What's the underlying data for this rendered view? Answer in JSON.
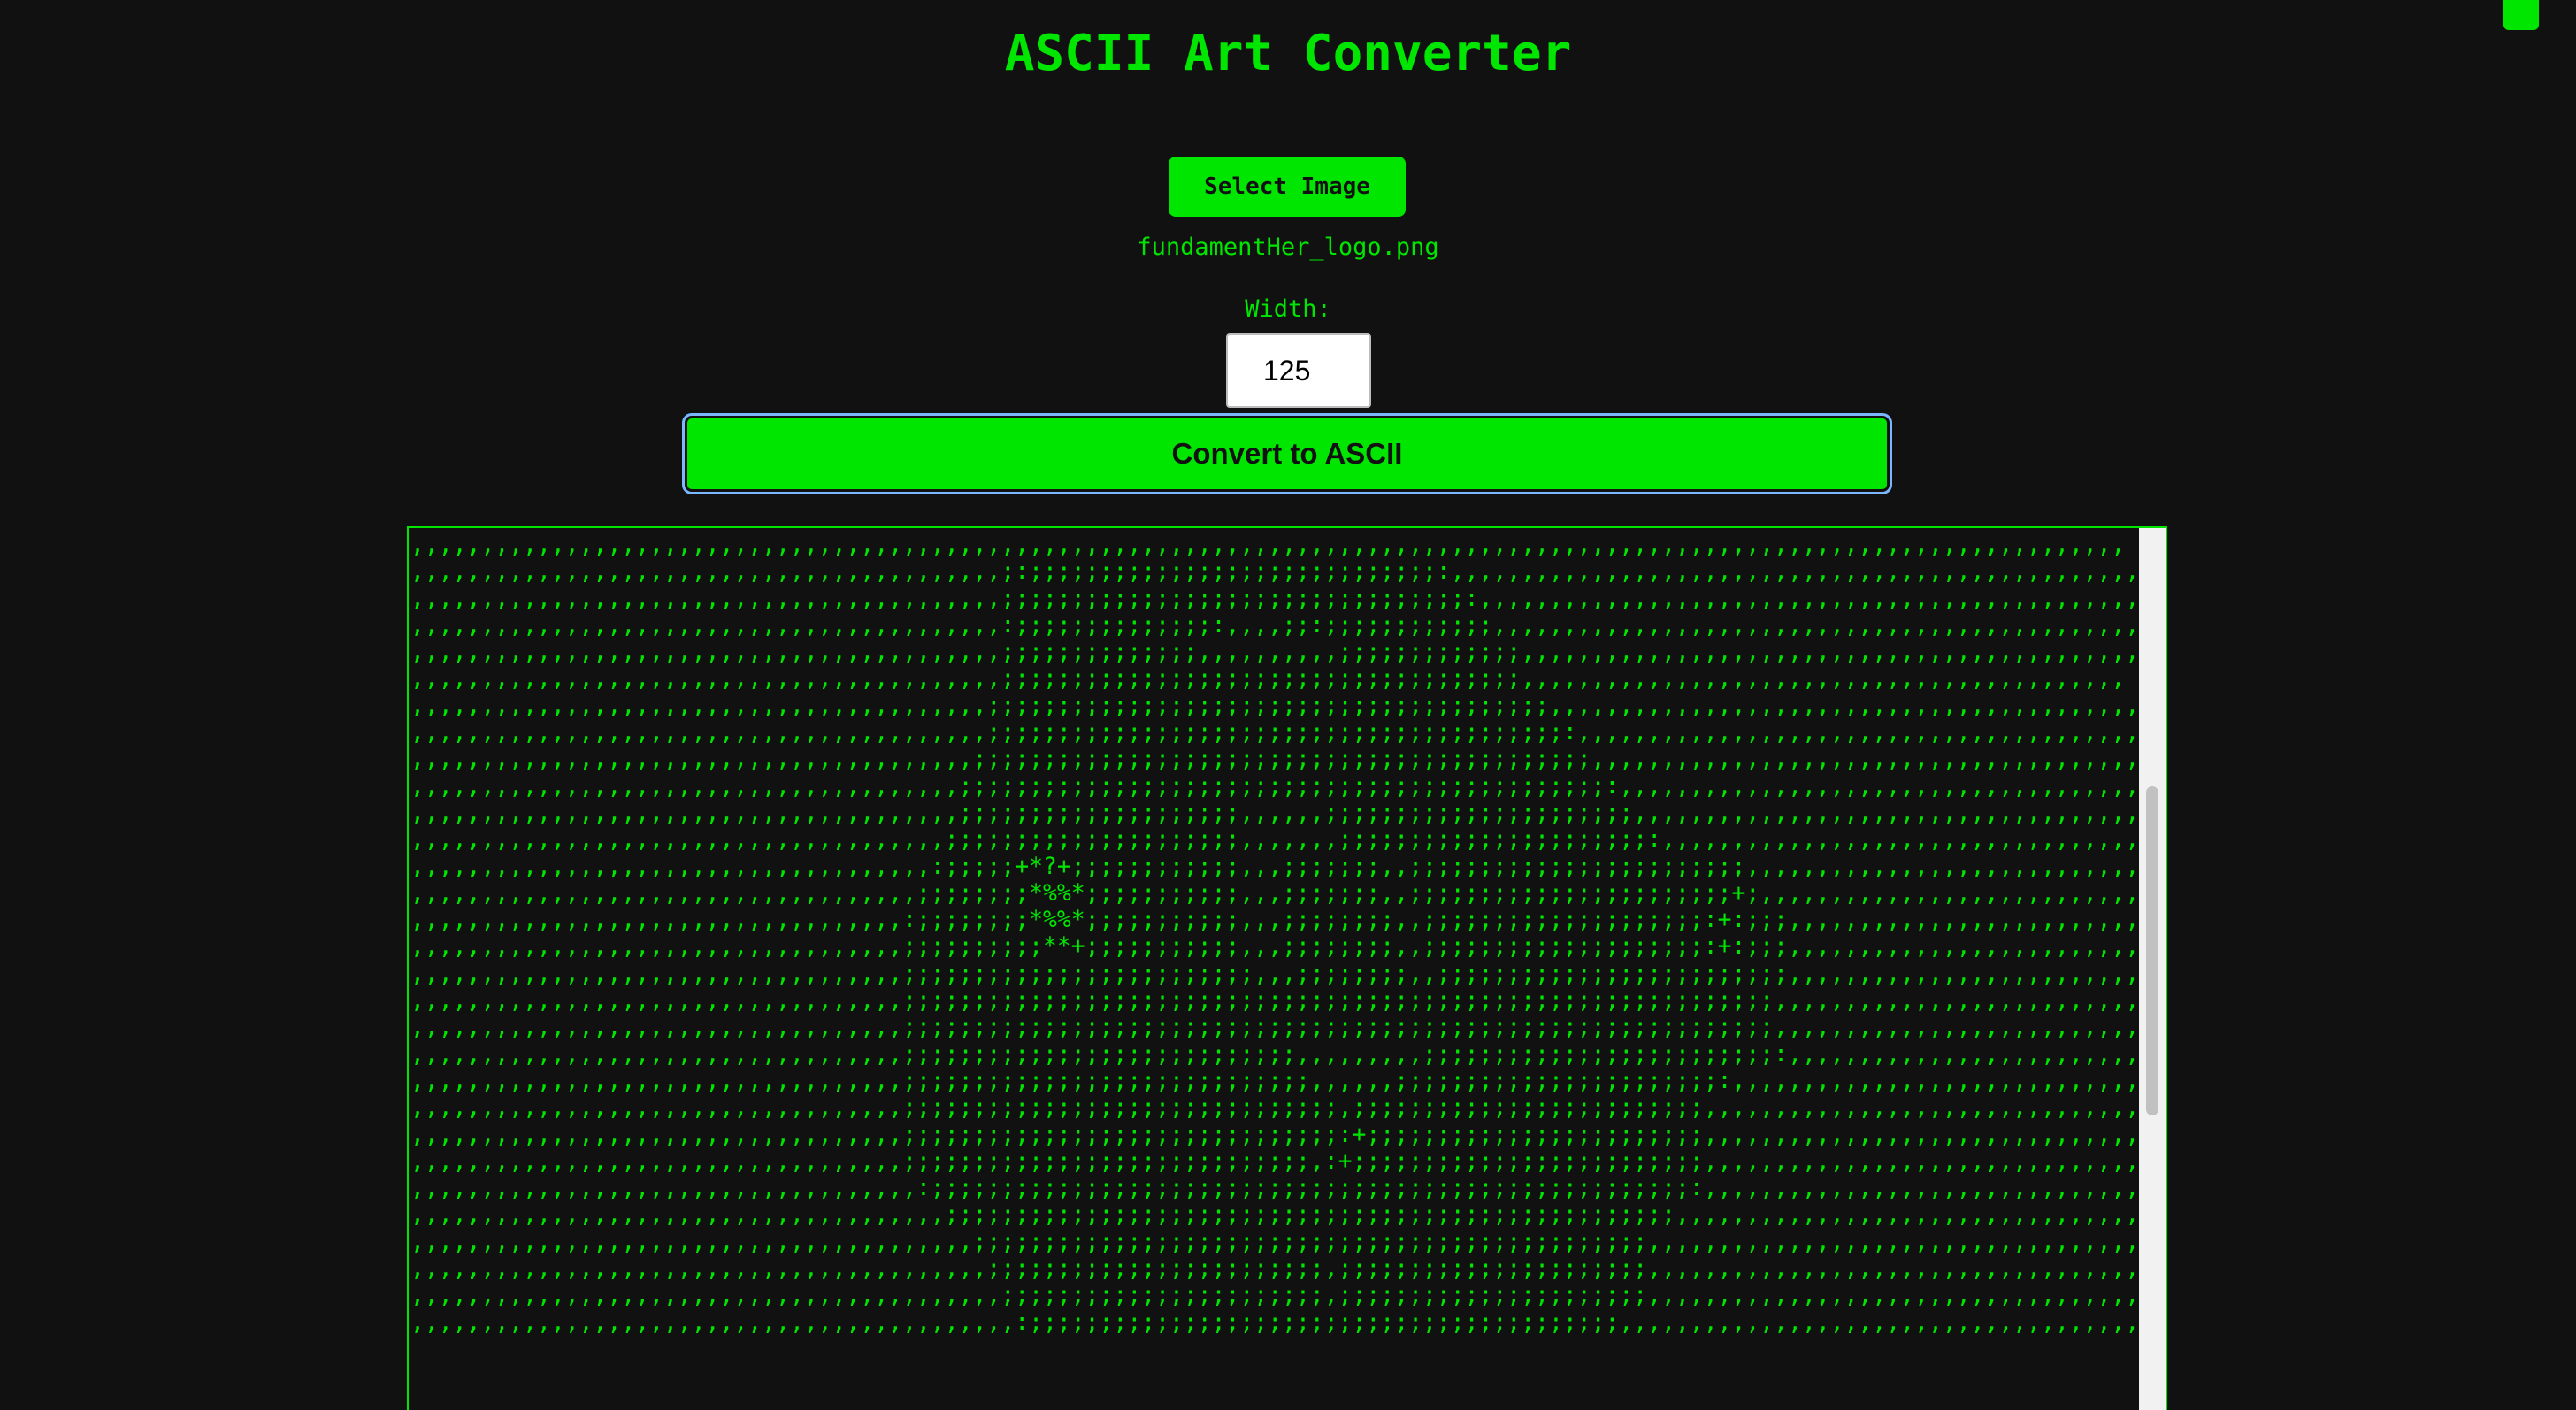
{
  "header": {
    "title": "ASCII Art Converter"
  },
  "controls": {
    "select_label": "Select Image",
    "file_name": "fundamentHer_logo.png",
    "width_label": "Width:",
    "width_value": "125",
    "convert_label": "Convert to ASCII"
  },
  "output": {
    "ascii_text": ",,,,,,,,,,,,,,,,,,,,,,,,,,,,,,,,,,,,,,,,,,,,,,,,,,,,,,,,,,,,,,,,,,,,,,,,,,,,,,,,,,,,,,,,,,,,,,,,,,,,,,,,,,,,,,,,,,,,,,,,,,\n,,,,,,,,,,,,,,,,,,,,,,,,,,,,,,,,,,,,,,,,,,;:;;;;;;;;;;;;;;;;;;;;;;;;;;;;;:,,,,,,,,,,,,,,,,,,,,,,,,,,,,,,,,,,,,,,,,,,,,,,,,,,\n,,,,,,,,,,,,,,,,,,,,,,,,,,,,,,,,,,,,,,,,,,;;;;;;;;;;;;;;;;;;;;;;;;;;;;;;;;;:,,,,,,,,,,,,,,,,,,,,,,,,,,,,,,,,,,,,,,,,,,,,,,,,\n,,,,,,,,,,,,,,,,,,,,,,,,,,,,,,,,,,,,,,,,,,:;;;;;;;;;;;;;;:,,,,;;:;;;;;;;;;;;;,,,,,,,,,,,,,,,,,,,,,,,,,,,,,,,,,,,,,,,,,,,,,,\n,,,,,,,,,,,,,,,,,,,,,,,,,,,,,,,,,,,,,,,,,,;;;;;;;;;;;;;;,,,,,,,,,,;;;;;;;;;;;;;,,,,,,,,,,,,,,,,,,,,,,,,,,,,,,,,,,,,,,,,,,,,\n,,,,,,,,,,,,,,,,,,,,,,,,,,,,,,,,,,,,,,,,,,;;;;;;;;;;;;;;;;;;;;;;;;;;;;;;;;;;;;;,,,,,,,,,,,,,,,,,,,,,,,,,,,,,,,,,,,,,,,,,,,\n,,,,,,,,,,,,,,,,,,,,,,,,,,,,,,,,,,,,,,,,,;;;;;;;;;;;;;;;;;;;;;;;;;;;;;;;;;;;;;;;;,,,,,,,,,,,,,,,,,,,,,,,,,,,,,,,,,,,,,,,,,,\n,,,,,,,,,,,,,,,,,,,,,,,,,,,,,,,,,,,,,,,,,;;;;;;;;;;;;;;;;;;;;;;;;;;;;;;;;;;;;;;;;;:,,,,,,,,,,,,,,,,,,,,,,,,,,,,,,,,,,,,,,,,\n,,,,,,,,,,,,,,,,,,,,,,,,,,,,,,,,,,,,,,,,;;;;;;;;;;;;;;;;;;;;;;;;;;;;;;;;;;;;;;;;;;;;,,,,,,,,,,,,,,,,,,,,,,,,,,,,,,,,,,,,,,,\n,,,,,,,,,,,,,,,,,,,,,,,,,,,,,,,,,,,,,,,;;;;;;;;;;;;;;;;;;;;;;;;;;;;;;;;;;;;;;;;;;;;;;:,,,,,,,,,,,,,,,,,,,,,,,,,,,,,,,,,,,,,\n,,,,,,,,,,,,,,,,,,,,,,,,,,,,,,,,,,,,,,,;;;;;;;;;;;;;;;;;;;;,,,,,,;;;;;;;;;;;;;;;;;;;;;;,,,,,,,,,,,,,,,,,,,,,,,,,,,,,,,,,,,,\n,,,,,,,,,,,,,,,,,,,,,,,,,,,,,,,,,,,,,,;;;;;;;;;;;;;;;;;;;;;,,,,,,,;;;;;;;;;;;;;;;;;;;;;;:,,,,,,,,,,,,,,,,,,,,,,,,,,,,,,,,,,\n,,,,,,,,,,,,,,,,,,,,,,,,,,,,,,,,,,,,,:;;;;;+*?+;;;;;;;;;;;;,,,;;;;;;;,,;;;;;;;;;;;;;;;;;;;;;;;;,,,,,,,,,,,,,,,,,,,,,,,,,,,,,,,\n,,,,,,,,,,,,,,,,,,,,,,,,,,,,,,,,,,,,;;;;;;;;*%%*;;;;;;;;;;;,,,;;;;;;;,,;;;;;;;;;;;;;;;;;;;;;;;+;,,,,,,,,,,,,,,,,,,,,,,,,,,,,\n,,,,,,,,,,,,,,,,,,,,,,,,,,,,,,,,,,,:;;;;;;;;*%%*;;;;;;;;;;;,,,;;;;;;;;,,;;;;;;;;;;;;;;;;;;;;:+:;;;,,,,,,,,,,,,,,,,,,,,,,,,,,\n,,,,,,,,,,,,,,,,,,,,,,,,,,,,,,,,,,,;;;;;;;;;;**+;;;;;;;;;;;,,,;;;;;;;;,,;;;;;;;;;;;;;;;;;;;;:+:;;;,,,,,,,,,,,,,,,,,,,,,,,,,,\n,,,,,,,,,,,,,,,,,,,,,,,,,,,,,,,,,,,;;;;;;;;;;;;;;;;;;;;;;;;;,,,;;;;;;;;,,;;;;;;;;;;;;;;;;;;;;;;;;;,,,,,,,,,,,,,,,,,,,,,,,,,,,\n,,,,,,,,,,,,,,,,,,,,,,,,,,,,,,,,,,,;;;;;;;;;;;;;;;;;;;;;;;;;;;;;;;;;;;;;;;;;;;;;;;;;;;;;;;;;;;;;;,,,,,,,,,,,,,,,,,,,,,,,,,,,\n,,,,,,,,,,,,,,,,,,,,,,,,,,,,,,,,,,,;;;;;;;;;;;;;;;;;;;;;;;;;;;;;;;;;;;;;;;;;;;;;;;;;;;;;;;;;;;;;;,,,,,,,,,,,,,,,,,,,,,,,,,,,\n,,,,,,,,,,,,,,,,,,,,,,,,,,,,,,,,,,,;;;;;;;;;;;;;;;;;;;;;;;;;;;;,,,,,,,,,;;;;;;;;;;;;;;;;;;;;;;;;;:,,,,,,,,,,,,,,,,,,,,,,,,,,\n,,,,,,,,,,,,,,,,,,,,,,,,,,,,,,,,,,,;;;;;;;;;;;;;;;;;;;;;;;;;;;;;,,,,,,;;;;;;;;;;;;;;;;;;;;;;;:,,,,,,,,,,,,,,,,,,,,,,,,,,,,,,\n,,,,,,,,,,,,,,,,,,,,,,,,,,,,,,,,,,,;;;;;;;;;;;;;;;;;;;;;;;;;;;;;;;,;;;;;;;;;;;;;;;;;;;;;;;;;,,,,,,,,,,,,,,,,,,,,,,,,,,,,,,,,\n,,,,,,,,,,,,,,,,,,,,,,,,,,,,,,,,,,,;;;;;;;;;;;;;;;;;;;;;;;;;;;;;;;:+;;;;;;;;;;;;;;;;;;;;;;;;,,,,,,,,,,,,,,,,,,,,,,,,,,,,,,,,\n,,,,,,,,,,,,,,,,,,,,,,,,,,,,,,,,,,,;;;;;;;;;;;;;;;;;;;;;;;;;;;;;,:+;;;;;;;;;;;;;;;;;;;;;;;;;,,,,,,,,,,,,,,,,,,,,,,,,,,,,,,,,\n,,,,,,,,,,,,,,,,,,,,,,,,,,,,,,,,,,,,:;;;;;;;;;;;;;;;;;;;;;;;;;;;;;;;;;;;;;;;;;;;;;;;;;;;;;;:,,,,,,,,,,,,,,,,,,,,,,,,,,,,,,,,\n,,,,,,,,,,,,,,,,,,,,,,,,,,,,,,,,,,,,,,;;;;;;;;;;;;;;;;;;;;;;;;;;;;;;;;;;;;;;;;;;;;;;;;;;;;,,,,,,,,,,,,,,,,,,,,,,,,,,,,,,,,,,\n,,,,,,,,,,,,,,,,,,,,,,,,,,,,,,,,,,,,,,,,;;;;;;;;;;;;;;;;;;;;;;;;;;;;;;;;;;;;;;;;;;;;;;;;,,,,,,,,,,,,,,,,,,,,,,,,,,,,,,,,,,,,\n,,,,,,,,,,,,,,,,,,,,,,,,,,,,,,,,,,,,,,,,,;;;;;;;;;;;;;;;;;;;;;;;;,;;;;;;;;;;;;;;;;;;;;;;,,,,,,,,,,,,,,,,,,,,,,,,,,,,,,,,,,,,\n,,,,,,,,,,,,,,,,,,,,,,,,,,,,,,,,,,,,,,,,,,;;;;;;;;;;;;;;;;;;;;;;;,;;;;;;;;;;;;;;;;;;;;;;,,,,,,,,,,,,,,,,,,,,,,,,,,,,,,,,,,,,\n,,,,,,,,,,,,,,,,,,,,,,,,,,,,,,,,,,,,,,,,,,,:;;;;;;;;;;;;;;;;;;;;;;;;;;;;;;;;;;;;;;;;;;,,,,,,,,,,,,,,,,,,,,,,,,,,,,,,,,,,,,,"
  }
}
